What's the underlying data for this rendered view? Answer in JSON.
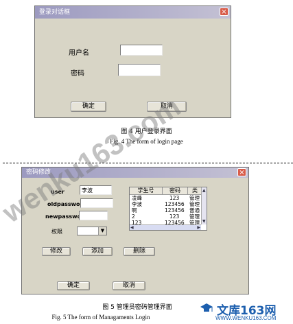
{
  "fig4": {
    "dialog": {
      "title": "登录对话框",
      "close": "×",
      "username_label": "用户名",
      "password_label": "密码",
      "username_value": "",
      "password_value": "",
      "ok_button": "确定",
      "cancel_button": "取消"
    },
    "caption_cn": "图 4   用户登录界面",
    "caption_en": "Fig. 4    The form of login page"
  },
  "fig5": {
    "dialog": {
      "title": "密码修改",
      "close": "×",
      "user_label": "user",
      "oldpassword_label": "oldpassword",
      "newpassword_label": "newpassword",
      "permission_label": "权限",
      "user_value": "李波",
      "oldpassword_value": "",
      "newpassword_value": "",
      "permission_value": "",
      "modify_button": "修改",
      "add_button": "添加",
      "delete_button": "删除",
      "ok_button": "确定",
      "cancel_button": "取消",
      "grid": {
        "columns": [
          "学生号",
          "密码",
          "类"
        ],
        "rows": [
          [
            "凌峰",
            "123",
            "管理"
          ],
          [
            "李波",
            "123456",
            "管理"
          ],
          [
            "啊",
            "123456",
            "普通"
          ],
          [
            "2",
            "123",
            "管理"
          ],
          [
            "123",
            "123456",
            "管理"
          ]
        ]
      }
    },
    "caption_cn": "图 5   管理员密码管理界面",
    "caption_en": "Fig. 5    The form of Managaments Login"
  },
  "watermark": {
    "text": "wenku163.com",
    "logo_text": "文库163网",
    "logo_url": "WWW.WENKU163.COM",
    "logo_highlight_color": "#e8302a",
    "logo_text_color": "#1d5fae"
  }
}
